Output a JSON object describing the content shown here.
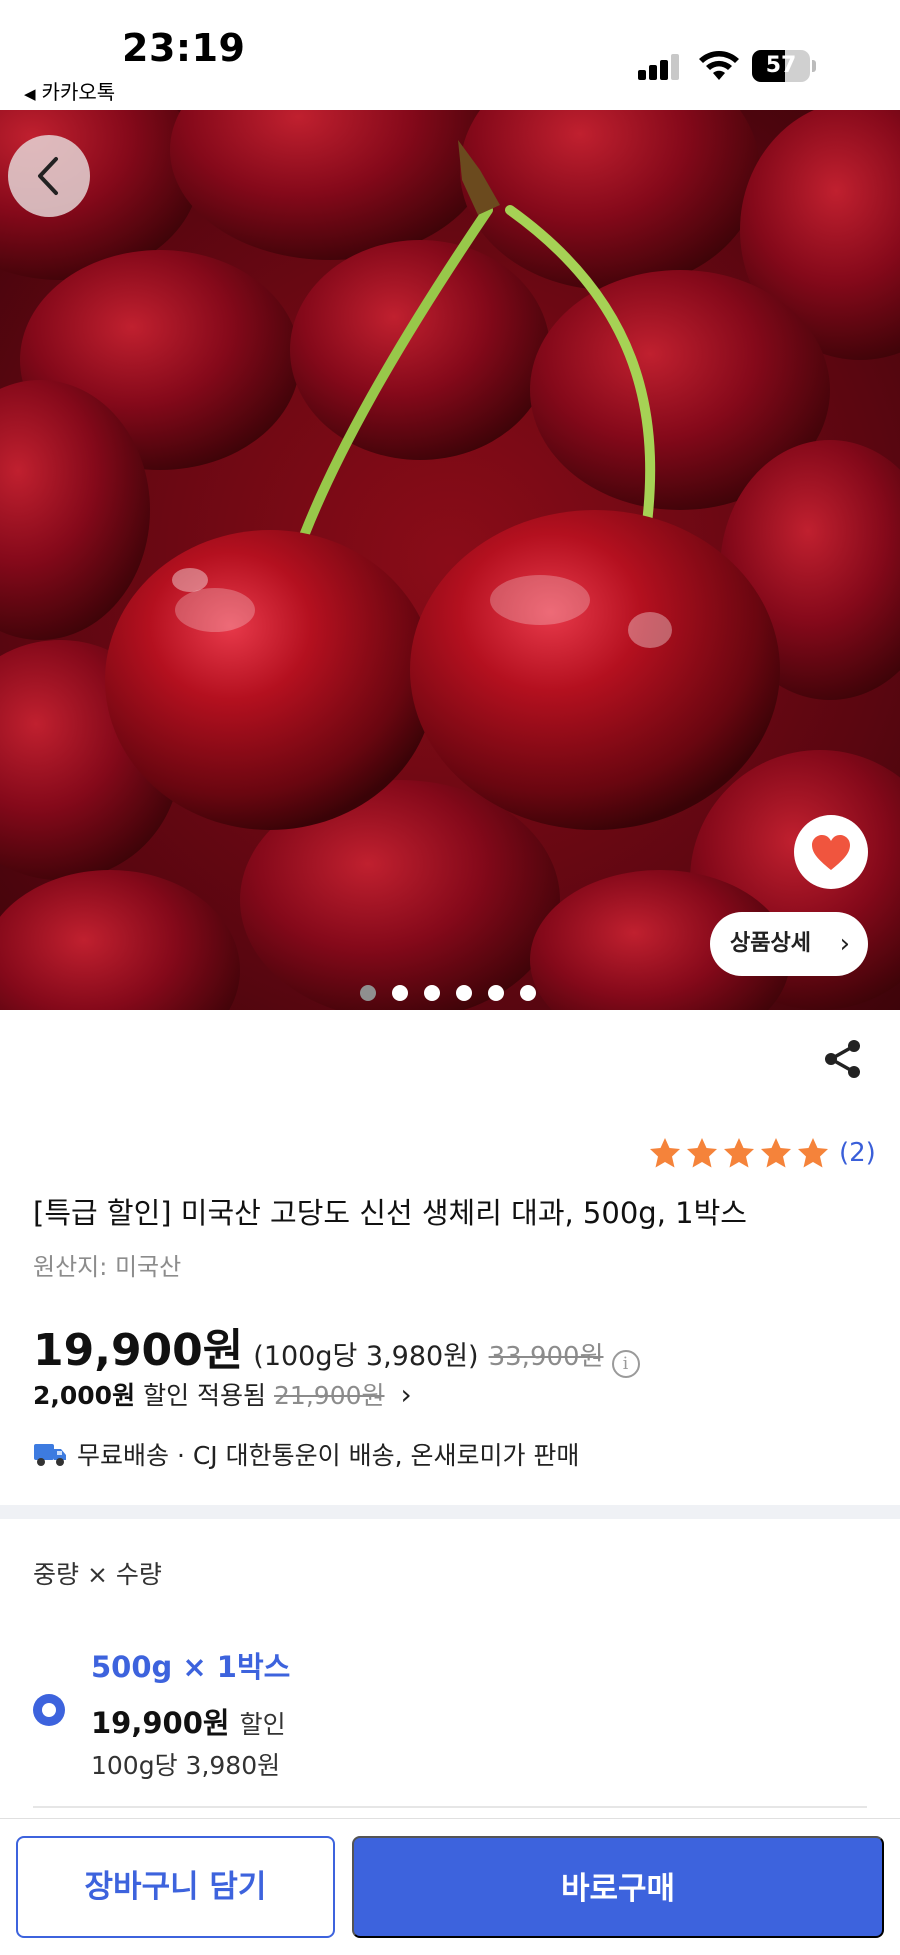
{
  "status_bar": {
    "time": "23:19",
    "back_app": "카카오톡",
    "battery": "57",
    "battery_level": 0.57
  },
  "hero": {
    "image_alt": "빨간 체리 사진",
    "detail_button": "상품상세",
    "page_count": 6,
    "active_page": 1
  },
  "product": {
    "rating_count": "(2)",
    "rating_stars": 5,
    "title": "[특급 할인] 미국산 고당도 신선 생체리 대과, 500g, 1박스",
    "origin": "원산지: 미국산",
    "price": "19,900원",
    "unit_price": "(100g당 3,980원)",
    "original_price": "33,900원",
    "info_icon": "i",
    "discount_amount": "2,000원",
    "discount_text": "할인 적용됨",
    "discount_old_price": "21,900원",
    "shipping": "무료배송 · CJ 대한통운이 배송, 온새로미가 판매"
  },
  "options": {
    "label": "중량 × 수량",
    "items": [
      {
        "name": "500g × 1박스",
        "price": "19,900원",
        "tag": "할인",
        "unit": "100g당 3,980원",
        "selected": true
      }
    ]
  },
  "bottom_bar": {
    "cart_label": "장바구니 담기",
    "buy_label": "바로구매"
  },
  "colors": {
    "accent": "#3d63dd",
    "rating": "#f5833a",
    "heart": "#f0553e"
  },
  "icons": {
    "back": "chevron-left-icon",
    "like": "heart-icon",
    "share": "share-icon",
    "shipping": "truck-icon",
    "info": "info-icon"
  }
}
